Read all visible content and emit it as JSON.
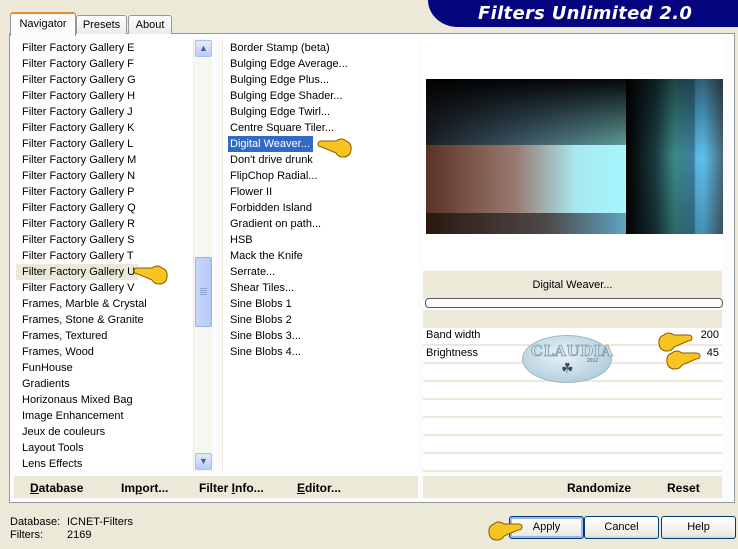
{
  "app": {
    "title": "Filters Unlimited 2.0"
  },
  "tabs": [
    {
      "label": "Navigator",
      "active": true
    },
    {
      "label": "Presets",
      "active": false
    },
    {
      "label": "About",
      "active": false
    }
  ],
  "categories": {
    "selected": "Filter Factory Gallery U",
    "items": [
      "Filter Factory Gallery E",
      "Filter Factory Gallery F",
      "Filter Factory Gallery G",
      "Filter Factory Gallery H",
      "Filter Factory Gallery J",
      "Filter Factory Gallery K",
      "Filter Factory Gallery L",
      "Filter Factory Gallery M",
      "Filter Factory Gallery N",
      "Filter Factory Gallery P",
      "Filter Factory Gallery Q",
      "Filter Factory Gallery R",
      "Filter Factory Gallery S",
      "Filter Factory Gallery T",
      "Filter Factory Gallery U",
      "Filter Factory Gallery V",
      "Frames, Marble & Crystal",
      "Frames, Stone & Granite",
      "Frames, Textured",
      "Frames, Wood",
      "FunHouse",
      "Gradients",
      "Horizonaus Mixed Bag",
      "Image Enhancement",
      "Jeux de couleurs",
      "Layout Tools",
      "Lens Effects"
    ]
  },
  "filters": {
    "selected": "Digital Weaver...",
    "items": [
      "Border Stamp (beta)",
      "Bulging Edge Average...",
      "Bulging Edge Plus...",
      "Bulging Edge Shader...",
      "Bulging Edge Twirl...",
      "Centre Square Tiler...",
      "Digital Weaver...",
      "Don't drive drunk",
      "FlipChop Radial...",
      "Flower II",
      "Forbidden Island",
      "Gradient on path...",
      "HSB",
      "Mack the Knife",
      "Serrate...",
      "Shear Tiles...",
      "Sine Blobs 1",
      "Sine Blobs 2",
      "Sine Blobs 3...",
      "Sine Blobs 4..."
    ]
  },
  "preview": {
    "filter_name": "Digital Weaver...",
    "progress": 0
  },
  "parameters": [
    {
      "label": "Band width",
      "value": "200"
    },
    {
      "label": "Brightness",
      "value": "45"
    }
  ],
  "watermark": {
    "text": "CLAUDIA",
    "year": "2012"
  },
  "bottom_links": {
    "database": "Database",
    "import": "Import...",
    "filter_info": "Filter Info...",
    "editor": "Editor...",
    "randomize": "Randomize",
    "reset": "Reset"
  },
  "status": {
    "database_label": "Database:",
    "database_value": "ICNET-Filters",
    "filters_label": "Filters:",
    "filters_value": "2169"
  },
  "buttons": {
    "apply": "Apply",
    "cancel": "Cancel",
    "help": "Help"
  }
}
